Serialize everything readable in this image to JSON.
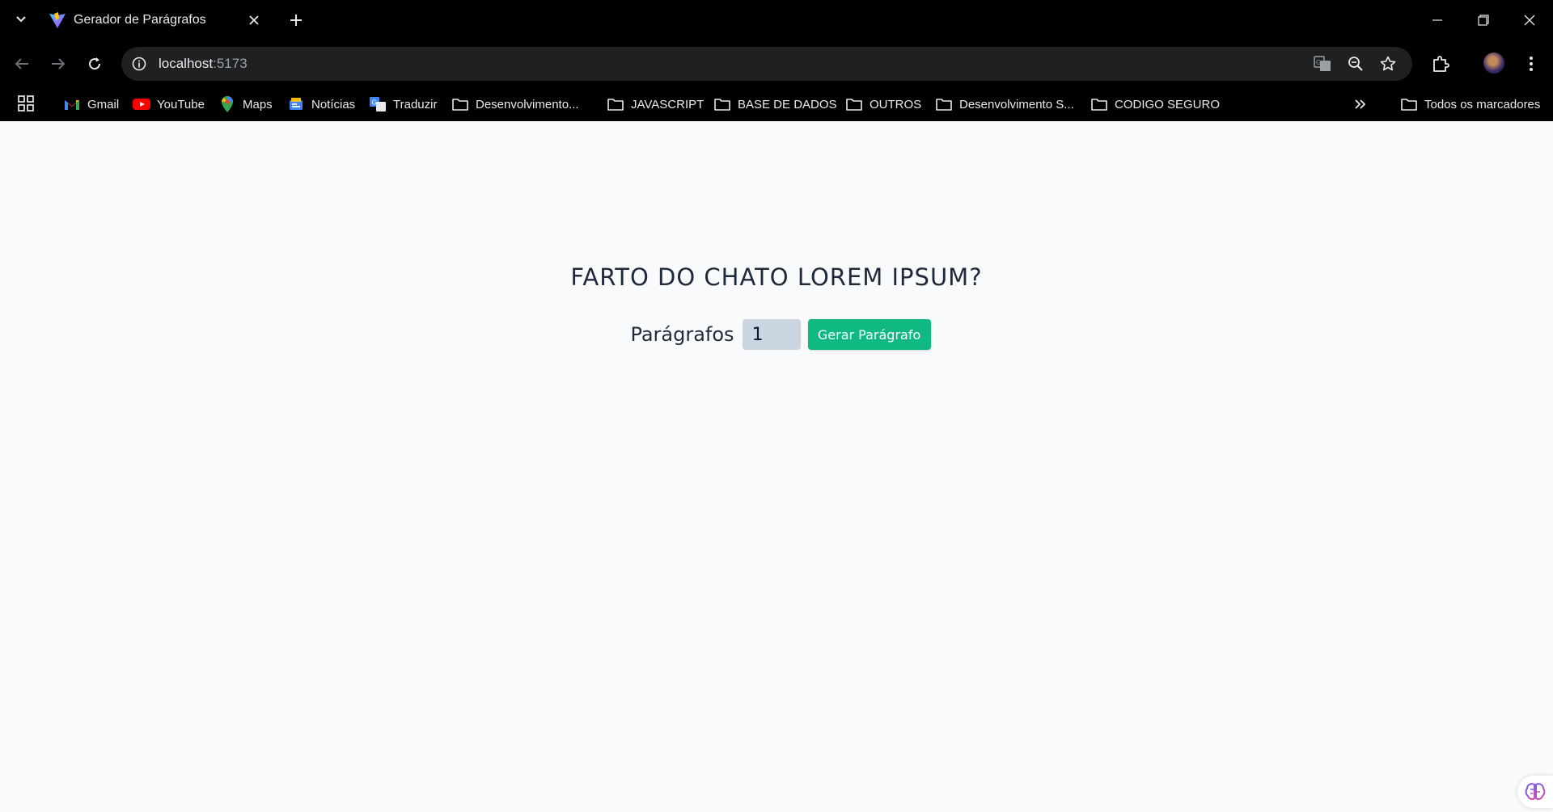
{
  "browser": {
    "tab": {
      "title": "Gerador de Parágrafos"
    },
    "address": {
      "host": "localhost",
      "port": ":5173"
    },
    "bookmarks": [
      {
        "label": "Gmail",
        "icon": "gmail-icon"
      },
      {
        "label": "YouTube",
        "icon": "youtube-icon"
      },
      {
        "label": "Maps",
        "icon": "maps-icon"
      },
      {
        "label": "Notícias",
        "icon": "news-icon"
      },
      {
        "label": "Traduzir",
        "icon": "translate-icon"
      },
      {
        "label": "Desenvolvimento...",
        "icon": "folder-icon"
      },
      {
        "label": "JAVASCRIPT",
        "icon": "folder-icon"
      },
      {
        "label": "BASE DE DADOS",
        "icon": "folder-icon"
      },
      {
        "label": "OUTROS",
        "icon": "folder-icon"
      },
      {
        "label": "Desenvolvimento S...",
        "icon": "folder-icon"
      },
      {
        "label": "CODIGO SEGURO",
        "icon": "folder-icon"
      }
    ],
    "all_bookmarks_label": "Todos os marcadores"
  },
  "page": {
    "heading": "FARTO DO CHATO LOREM IPSUM?",
    "form": {
      "label": "Parágrafos",
      "input_value": "1",
      "button_label": "Gerar Parágrafo"
    }
  },
  "colors": {
    "accent": "#10b981",
    "page_bg": "#f8fafc",
    "input_bg": "#cbd5e1",
    "chrome_bg": "#000000"
  }
}
